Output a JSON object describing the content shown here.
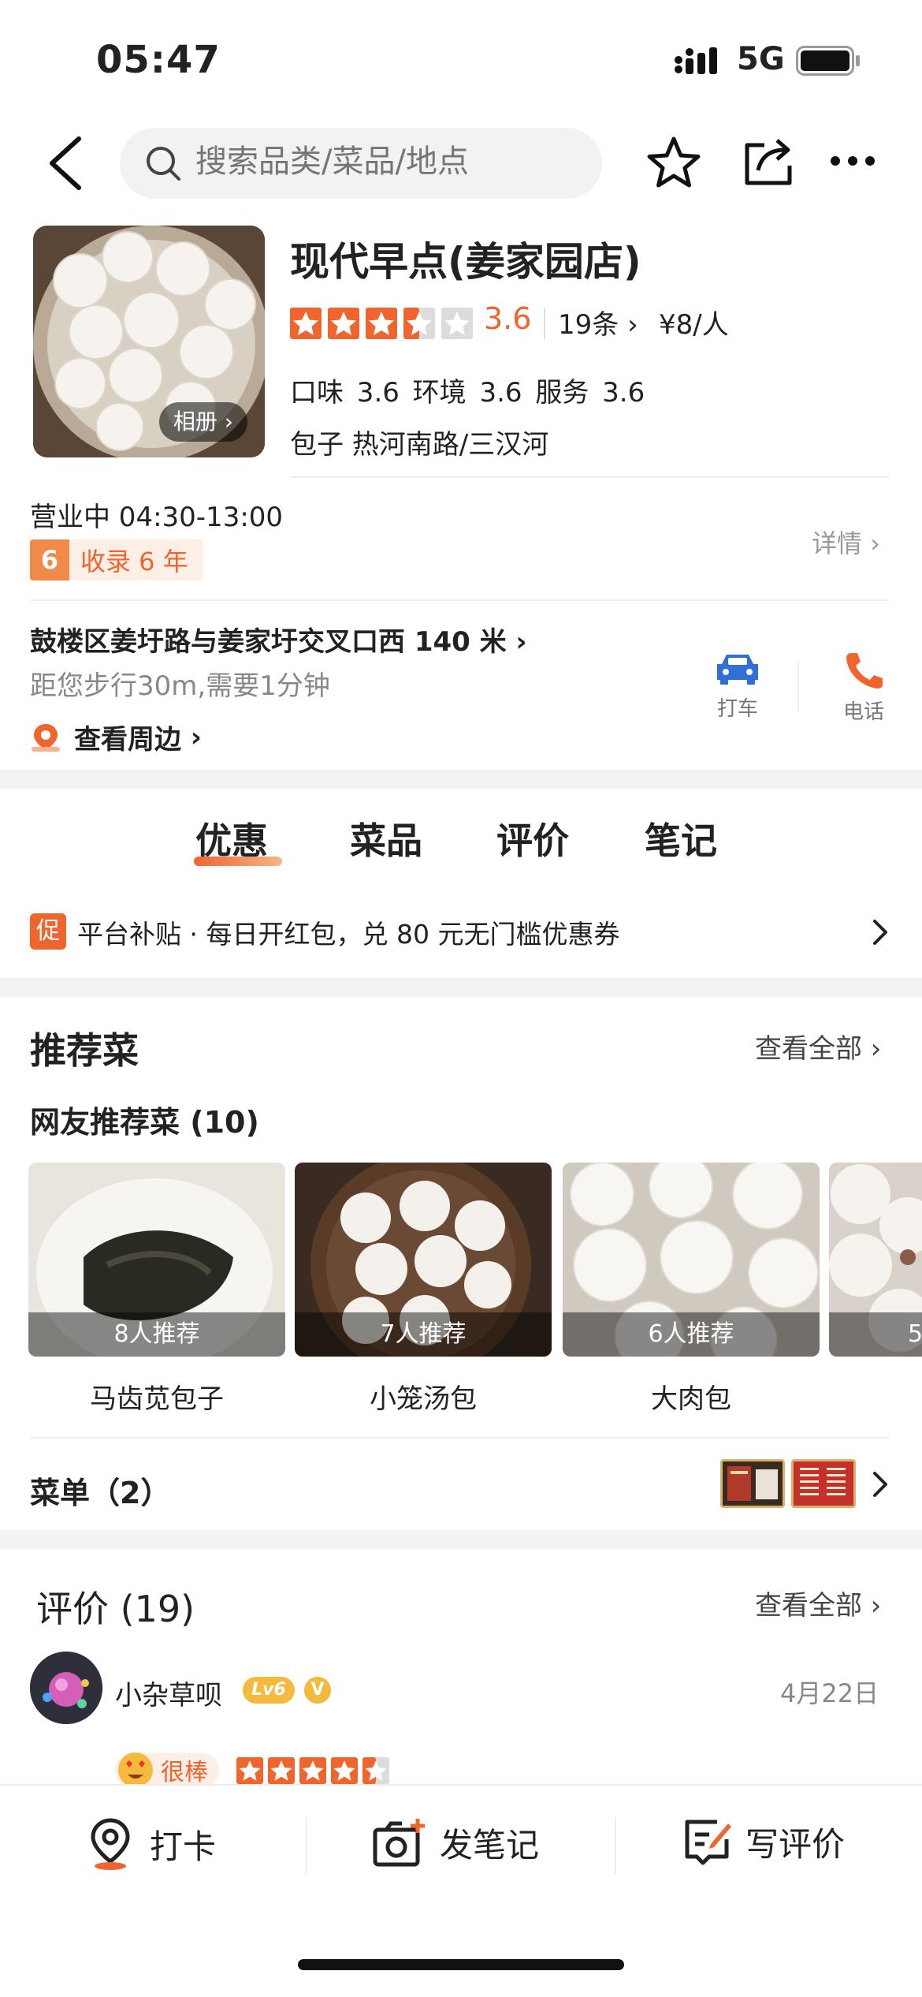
{
  "status_bar": {
    "time": "05:47",
    "network": "5G"
  },
  "nav": {
    "search_placeholder": "搜索品类/菜品/地点"
  },
  "shop": {
    "name": "现代早点(姜家园店)",
    "album_label": "相册",
    "rating": 3.6,
    "score_text": "3.6",
    "stars_value": 3.5,
    "review_count_label": "19条",
    "price_label": "¥8/人",
    "subscores_label": "口味 3.6  环境 3.6  服务 3.6",
    "tags_label": "包子  热河南路/三汉河",
    "hours_label": "营业中  04:30-13:00",
    "years_badge_num": "6",
    "years_badge_text": "收录 6 年",
    "detail_label": "详情",
    "address": "鼓楼区姜圩路与姜家圩交叉口西 140 米",
    "distance": "距您步行30m,需要1分钟",
    "nearby_label": "查看周边",
    "taxi_label": "打车",
    "call_label": "电话"
  },
  "tabs": [
    {
      "label": "优惠",
      "active": true
    },
    {
      "label": "菜品"
    },
    {
      "label": "评价"
    },
    {
      "label": "笔记"
    }
  ],
  "promo": {
    "badge": "促",
    "text": "平台补贴 · 每日开红包，兑 80 元无门槛优惠券"
  },
  "recommended": {
    "title": "推荐菜",
    "view_all": "查看全部",
    "subtitle": "网友推荐菜 (10)",
    "dishes": [
      {
        "name": "马齿苋包子",
        "count": "8人推荐"
      },
      {
        "name": "小笼汤包",
        "count": "7人推荐"
      },
      {
        "name": "大肉包",
        "count": "6人推荐"
      },
      {
        "name": "",
        "count": "5"
      }
    ],
    "menu_label": "菜单（2）"
  },
  "reviews": {
    "title": "评价 (19)",
    "view_all": "查看全部",
    "items": [
      {
        "user": "小杂草呗",
        "level": "Lv6",
        "verified": "V",
        "date": "4月22日",
        "mood": "很棒",
        "stars": 4.5
      }
    ]
  },
  "bottom_bar": {
    "checkin": "打卡",
    "post_note": "发笔记",
    "write_review": "写评价"
  },
  "colors": {
    "accent": "#f0642e",
    "taxi_blue": "#2f6fd6",
    "gold": "#f5b93c"
  }
}
